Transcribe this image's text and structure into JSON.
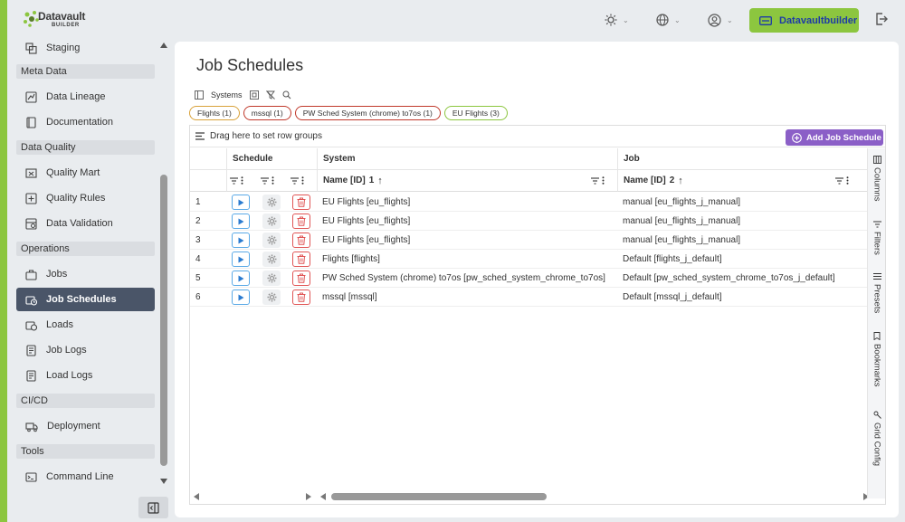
{
  "app": {
    "logo_text": "Datavault",
    "logo_sub": "BUILDER",
    "user_button": "Datavaultbuilder",
    "accent_color": "#8cc63f",
    "active_color": "#4a5568"
  },
  "sidebar": {
    "items": [
      {
        "label": "Staging",
        "icon": "staging-icon"
      },
      {
        "section": "Meta Data"
      },
      {
        "label": "Data Lineage",
        "icon": "lineage-icon"
      },
      {
        "label": "Documentation",
        "icon": "book-icon"
      },
      {
        "section": "Data Quality"
      },
      {
        "label": "Quality Mart",
        "icon": "mart-icon"
      },
      {
        "label": "Quality Rules",
        "icon": "rules-icon"
      },
      {
        "label": "Data Validation",
        "icon": "validation-icon"
      },
      {
        "section": "Operations"
      },
      {
        "label": "Jobs",
        "icon": "briefcase-icon"
      },
      {
        "label": "Job Schedules",
        "icon": "schedule-icon",
        "active": true
      },
      {
        "label": "Loads",
        "icon": "loads-icon"
      },
      {
        "label": "Job Logs",
        "icon": "log-icon"
      },
      {
        "label": "Load Logs",
        "icon": "log-icon"
      },
      {
        "section": "CI/CD"
      },
      {
        "label": "Deployment",
        "icon": "truck-icon"
      },
      {
        "section": "Tools"
      },
      {
        "label": "Command Line",
        "icon": "terminal-icon"
      }
    ]
  },
  "main": {
    "title": "Job Schedules",
    "toolbar_label": "Systems",
    "chips": [
      {
        "label": "Flights (1)",
        "color": "#d9a23a"
      },
      {
        "label": "mssql (1)",
        "color": "#c0392b"
      },
      {
        "label": "PW Sched System (chrome) to7os (1)",
        "color": "#c0392b"
      },
      {
        "label": "EU Flights (3)",
        "color": "#8cc63f"
      }
    ],
    "row_group_hint": "Drag here to set row groups",
    "add_button": "Add Job Schedule",
    "groups": {
      "schedule": "Schedule",
      "system": "System",
      "job": "Job"
    },
    "columns": {
      "system": "Name [ID]",
      "system_sort": "1",
      "job": "Name [ID]",
      "job_sort": "2"
    },
    "rows": [
      {
        "n": "1",
        "system": "EU Flights [eu_flights]",
        "job": "manual [eu_flights_j_manual]"
      },
      {
        "n": "2",
        "system": "EU Flights [eu_flights]",
        "job": "manual [eu_flights_j_manual]"
      },
      {
        "n": "3",
        "system": "EU Flights [eu_flights]",
        "job": "manual [eu_flights_j_manual]"
      },
      {
        "n": "4",
        "system": "Flights [flights]",
        "job": "Default [flights_j_default]"
      },
      {
        "n": "5",
        "system": "PW Sched System (chrome) to7os [pw_sched_system_chrome_to7os]",
        "job": "Default [pw_sched_system_chrome_to7os_j_default]"
      },
      {
        "n": "6",
        "system": "mssql [mssql]",
        "job": "Default [mssql_j_default]"
      }
    ],
    "side_tabs": [
      "Columns",
      "Filters",
      "Presets",
      "Bookmarks",
      "Grid Config"
    ]
  }
}
